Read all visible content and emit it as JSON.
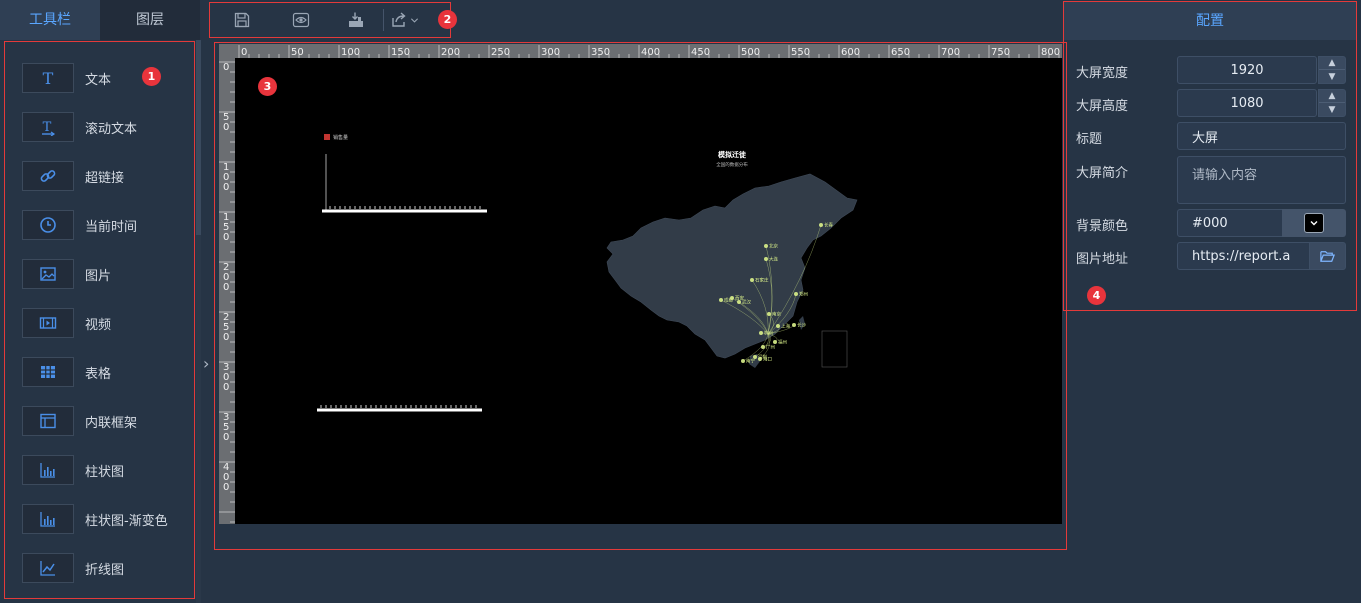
{
  "tabs": {
    "toolbox": "工具栏",
    "layers": "图层"
  },
  "tools": [
    {
      "label": "文本",
      "icon": "text-icon"
    },
    {
      "label": "滚动文本",
      "icon": "scroll-text-icon"
    },
    {
      "label": "超链接",
      "icon": "link-icon"
    },
    {
      "label": "当前时间",
      "icon": "clock-icon"
    },
    {
      "label": "图片",
      "icon": "image-icon"
    },
    {
      "label": "视频",
      "icon": "video-icon"
    },
    {
      "label": "表格",
      "icon": "table-icon"
    },
    {
      "label": "内联框架",
      "icon": "iframe-icon"
    },
    {
      "label": "柱状图",
      "icon": "bar-chart-icon"
    },
    {
      "label": "柱状图-渐变色",
      "icon": "bar-chart-gradient-icon"
    },
    {
      "label": "折线图",
      "icon": "line-chart-icon"
    }
  ],
  "toolbar": {
    "buttons": [
      "save-icon",
      "preview-icon",
      "import-icon",
      "export-icon"
    ]
  },
  "badges": {
    "b1": "1",
    "b2": "2",
    "b3": "3",
    "b4": "4"
  },
  "ruler": {
    "h_labels": [
      "0",
      "50",
      "100",
      "150",
      "200",
      "250",
      "300",
      "350",
      "400",
      "450",
      "500",
      "550",
      "600",
      "650",
      "700",
      "750",
      "800"
    ],
    "v_labels": [
      "0",
      "50",
      "100",
      "150",
      "200",
      "250",
      "300",
      "350",
      "400"
    ]
  },
  "stage": {
    "map_title": "模拟迁徙",
    "map_subtitle": "全国的数据分布",
    "legend_label": "销售量",
    "cities": [
      "长春",
      "北京",
      "大连",
      "石家庄",
      "郑州",
      "西安",
      "成都",
      "武汉",
      "南京",
      "上海",
      "长沙",
      "杭州",
      "福州",
      "广州",
      "深圳",
      "海口",
      "南宁"
    ]
  },
  "config": {
    "header": "配置",
    "width_label": "大屏宽度",
    "width_value": "1920",
    "height_label": "大屏高度",
    "height_value": "1080",
    "title_label": "标题",
    "title_value": "大屏",
    "intro_label": "大屏简介",
    "intro_placeholder": "请输入内容",
    "bg_label": "背景颜色",
    "bg_value": "#000",
    "img_label": "图片地址",
    "img_value": "https://report.a"
  },
  "colors": {
    "accent": "#5aa6ff",
    "badge": "#e8343c",
    "frame": "#e33a3a",
    "map": "#323c48",
    "route": "#d9f08a"
  }
}
